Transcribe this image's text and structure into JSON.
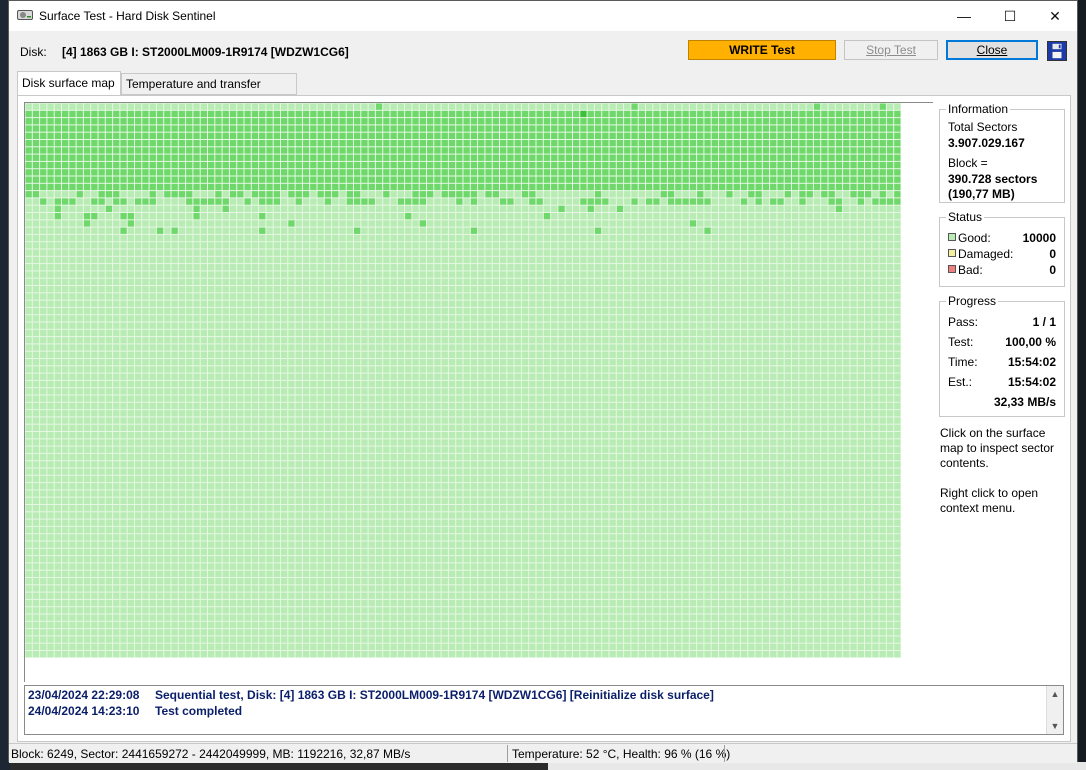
{
  "window": {
    "title": "Surface Test - Hard Disk Sentinel",
    "minimize_glyph": "—",
    "maximize_glyph": "☐",
    "close_glyph": "✕"
  },
  "toolbar": {
    "disk_label": "Disk:",
    "disk_name": "[4] 1863 GB I: ST2000LM009-1R9174 [WDZW1CG6]",
    "write_test_label": "WRITE Test",
    "stop_test_label": "Stop Test",
    "close_label": "Close",
    "save_icon": "floppy-disk-icon"
  },
  "tabs": [
    {
      "label": "Disk surface map",
      "active": true
    },
    {
      "label": "Temperature and transfer speed",
      "active": false
    }
  ],
  "surface_map": {
    "colors": {
      "light_good": "#b8ecb4",
      "bright_good": "#6fd86a",
      "dark_good": "#3cc038",
      "grid": "#e6f7e4"
    },
    "bright_rows_fraction": 0.155,
    "status": "all blocks good"
  },
  "information": {
    "title": "Information",
    "total_sectors_label": "Total Sectors",
    "total_sectors_value": "3.907.029.167",
    "block_label": "Block =",
    "block_sectors": "390.728 sectors",
    "block_size": "(190,77 MB)"
  },
  "status": {
    "title": "Status",
    "good_label": "Good:",
    "good_value": "10000",
    "good_color": "#b8ecb4",
    "damaged_label": "Damaged:",
    "damaged_value": "0",
    "damaged_color": "#f4f0a0",
    "bad_label": "Bad:",
    "bad_value": "0",
    "bad_color": "#f08080"
  },
  "progress": {
    "title": "Progress",
    "pass_label": "Pass:",
    "pass_value": "1 / 1",
    "test_label": "Test:",
    "test_value": "100,00 %",
    "time_label": "Time:",
    "time_value": "15:54:02",
    "est_label": "Est.:",
    "est_value": "15:54:02",
    "speed_value": "32,33 MB/s"
  },
  "hints": {
    "inspect": "Click on the surface map to inspect sector contents.",
    "context": "Right click to open context menu."
  },
  "log": [
    {
      "time": "23/04/2024  22:29:08",
      "text": "Sequential test, Disk: [4] 1863 GB I: ST2000LM009-1R9174 [WDZW1CG6] [Reinitialize disk surface]"
    },
    {
      "time": "24/04/2024  14:23:10",
      "text": "Test completed"
    }
  ],
  "statusbar": {
    "block_info": "Block: 6249, Sector: 2441659272 - 2442049999, MB: 1192216, 32,87 MB/s",
    "health_info": "Temperature: 52  °C,  Health: 96 % (16 %)"
  }
}
